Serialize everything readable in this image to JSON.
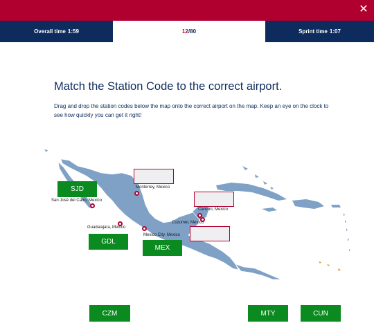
{
  "header": {
    "close_icon": "close-icon",
    "overall_label": "Overall time",
    "overall_time": "1:59",
    "progress_current": "12",
    "progress_total": "/80",
    "sprint_label": "Sprint time",
    "sprint_time": "1:07"
  },
  "main": {
    "title": "Match the Station Code to the correct airport.",
    "instructions": "Drag and drop the station codes below the map onto the correct airport on the map. Keep an eye on the clock to see how quickly you can get it right!"
  },
  "map": {
    "places": [
      {
        "id": "monterrey",
        "label": "Monterrey, Mexico"
      },
      {
        "id": "san-jose-del-cabo",
        "label": "San José del Cabo, Mexico"
      },
      {
        "id": "guadalajara",
        "label": "Guadalajara, Mexico"
      },
      {
        "id": "mexico-city",
        "label": "Mexico City, Mexico"
      },
      {
        "id": "cancun",
        "label": "Cancun, Mexico"
      },
      {
        "id": "cozumel",
        "label": "Cozumel, Mexico"
      }
    ],
    "colors": {
      "land": "#7fa1c6",
      "border": "#ffffff",
      "pin": "#b0002f",
      "highlight": "#e29a2a"
    }
  },
  "codes": {
    "placed": [
      {
        "code": "SJD"
      },
      {
        "code": "GDL"
      },
      {
        "code": "MEX"
      }
    ],
    "tray": [
      {
        "code": "CZM"
      },
      {
        "code": "MTY"
      },
      {
        "code": "CUN"
      }
    ]
  },
  "colors": {
    "brand_red": "#b0002f",
    "navy": "#0d2b5c",
    "button_green": "#0a8a1f"
  }
}
